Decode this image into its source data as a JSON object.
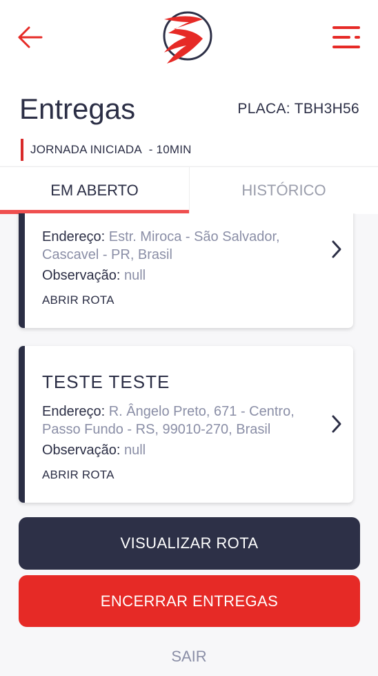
{
  "header": {
    "title": "Entregas",
    "plate_label": "PLACA:",
    "plate_value": "TBH3H56",
    "journey_status": "JORNADA INICIADA",
    "journey_separator": "  - ",
    "journey_time": "10MIN"
  },
  "tabs": [
    {
      "label": "EM ABERTO",
      "active": true
    },
    {
      "label": "HISTÓRICO",
      "active": false
    }
  ],
  "deliveries": [
    {
      "name": "",
      "address_label": "Endereço:",
      "address_line1": "Estr. Miroca - São Salvador,",
      "address_line2": "Cascavel - PR, Brasil",
      "note_label": "Observação:",
      "note_value": "null",
      "open_route": "ABRIR ROTA"
    },
    {
      "name": "TESTE  TESTE",
      "address_label": "Endereço:",
      "address_line1": "R. Ângelo Preto, 671 - Centro,",
      "address_line2": "Passo Fundo - RS, 99010-270, Brasil",
      "note_label": "Observação:",
      "note_value": "null",
      "open_route": "ABRIR ROTA"
    }
  ],
  "actions": {
    "view_route": "VISUALIZAR ROTA",
    "end_deliveries": "ENCERRAR ENTREGAS",
    "exit": "SAIR"
  },
  "colors": {
    "brand_red": "#e62a26",
    "dark_navy": "#2d3047",
    "muted_text": "#8a8ea6",
    "tab_indicator": "#ef4f4f"
  },
  "icons": {
    "back": "arrow-left-icon",
    "logo": "brand-logo",
    "menu": "menu-icon",
    "chevron": "chevron-right-icon"
  }
}
